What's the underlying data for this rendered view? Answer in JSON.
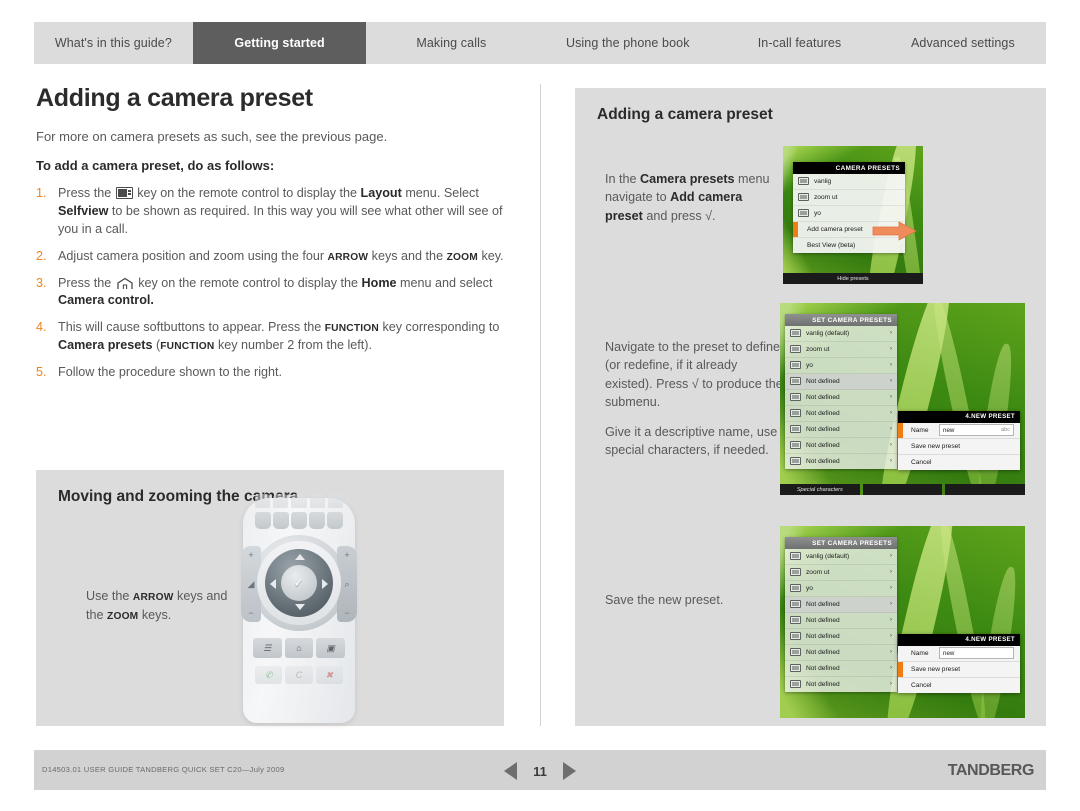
{
  "nav": {
    "tabs": [
      {
        "label": "What's in this guide?",
        "active": false
      },
      {
        "label": "Getting started",
        "active": true
      },
      {
        "label": "Making calls",
        "active": false
      },
      {
        "label": "Using the phone book",
        "active": false
      },
      {
        "label": "In-call features",
        "active": false
      },
      {
        "label": "Advanced settings",
        "active": false
      }
    ]
  },
  "left": {
    "title": "Adding a camera preset",
    "lead": "For more on camera presets as such, see the previous page.",
    "subhead": "To add a camera preset, do as follows:",
    "steps": {
      "s1_a": "Press the",
      "s1_b": "key on the remote control to display the",
      "s1_layout": "Layout",
      "s1_c": "menu. Select",
      "s1_selfview": "Selfview",
      "s1_d": "to be shown as required. In this way you will see what other will see of you in a call.",
      "s2_a": "Adjust camera position and zoom using the four",
      "s2_arrow": "ARROW",
      "s2_b": "keys and the",
      "s2_zoom": "ZOOM",
      "s2_c": "key.",
      "s3_a": "Press the",
      "s3_b": "key on the remote control to display the",
      "s3_home": "Home",
      "s3_c": "menu and select",
      "s3_cameracontrol": "Camera control.",
      "s4_a": "This will cause softbuttons to appear. Press the",
      "s4_function": "FUNCTION",
      "s4_b": "key corresponding to",
      "s4_presets": "Camera presets",
      "s4_c": "(",
      "s4_function2": "FUNCTION",
      "s4_d": "key number 2 from the left).",
      "s5": "Follow the procedure shown to the right."
    },
    "box": {
      "title": "Moving and zooming the camera",
      "caption_a": "Use the",
      "caption_arrow": "ARROW",
      "caption_b": "keys and the",
      "caption_zoom": "ZOOM",
      "caption_c": "keys."
    },
    "remote": {
      "ok_glyph": "✓",
      "vol_plus": "+",
      "vol_minus": "−",
      "zoom_plus": "+",
      "zoom_minus": "−",
      "zoom_icon": "⌕",
      "vol_icon": "◢",
      "book_icon": "☰",
      "home_icon": "⌂",
      "layout_icon": "▣",
      "call_icon": "✆",
      "clear_icon": "C",
      "end_icon": "✖"
    }
  },
  "right": {
    "title": "Adding a camera preset",
    "step1_text": {
      "a": "In the",
      "b_bold": "Camera presets",
      "c": "menu navigate to",
      "d_bold": "Add camera preset",
      "e": "and press √."
    },
    "step2_text": {
      "p1": "Navigate to the preset to define (or redefine, if it already existed). Press √ to produce the submenu.",
      "p2": "Give it a descriptive name, use special characters, if needed."
    },
    "step3_text": {
      "p1": "Save the new preset."
    },
    "shot1": {
      "header": "CAMERA PRESETS",
      "rows": [
        {
          "label": "vanlig",
          "icon": true,
          "selected": false,
          "marker": false
        },
        {
          "label": "zoom ut",
          "icon": true,
          "selected": false,
          "marker": false
        },
        {
          "label": "yo",
          "icon": true,
          "selected": false,
          "marker": false
        },
        {
          "label": "Add camera preset",
          "icon": false,
          "selected": false,
          "marker": true
        },
        {
          "label": "Best View (beta)",
          "icon": false,
          "selected": false,
          "marker": false
        }
      ],
      "footer": "Hide presets"
    },
    "shot2": {
      "header": "SET CAMERA PRESETS",
      "rows": [
        {
          "label": "vanlig (default)",
          "selected": false
        },
        {
          "label": "zoom ut",
          "selected": false
        },
        {
          "label": "yo",
          "selected": false
        },
        {
          "label": "Not defined",
          "selected": true
        },
        {
          "label": "Not defined",
          "selected": false
        },
        {
          "label": "Not defined",
          "selected": false
        },
        {
          "label": "Not defined",
          "selected": false
        },
        {
          "label": "Not defined",
          "selected": false
        },
        {
          "label": "Not defined",
          "selected": false
        }
      ],
      "softkeys": [
        "Special characters",
        "",
        ""
      ],
      "dialog": {
        "header": "4.NEW PRESET",
        "name_label": "Name",
        "name_value": "new",
        "name_hint": "abc",
        "save_label": "Save new preset",
        "cancel_label": "Cancel",
        "marker_row": "name"
      }
    },
    "shot3": {
      "header": "SET CAMERA PRESETS",
      "rows": [
        {
          "label": "vanlig (default)",
          "selected": false
        },
        {
          "label": "zoom ut",
          "selected": false
        },
        {
          "label": "yo",
          "selected": false
        },
        {
          "label": "Not defined",
          "selected": true
        },
        {
          "label": "Not defined",
          "selected": false
        },
        {
          "label": "Not defined",
          "selected": false
        },
        {
          "label": "Not defined",
          "selected": false
        },
        {
          "label": "Not defined",
          "selected": false
        },
        {
          "label": "Not defined",
          "selected": false
        }
      ],
      "dialog": {
        "header": "4.NEW PRESET",
        "name_label": "Name",
        "name_value": "new",
        "save_label": "Save new preset",
        "cancel_label": "Cancel",
        "marker_row": "save"
      }
    }
  },
  "footer": {
    "doc_text": "D14503.01 USER GUIDE TANDBERG QUICK SET C20—July 2009",
    "page": "11",
    "brand": "TANDBERG"
  },
  "colors": {
    "accent_orange": "#f0821e",
    "nav_bg": "#dcdcdc",
    "nav_active": "#5e5e5e",
    "panel_bg": "#dcdcdc",
    "footer_bg": "#d2d2d2",
    "text_body": "#58595b"
  }
}
